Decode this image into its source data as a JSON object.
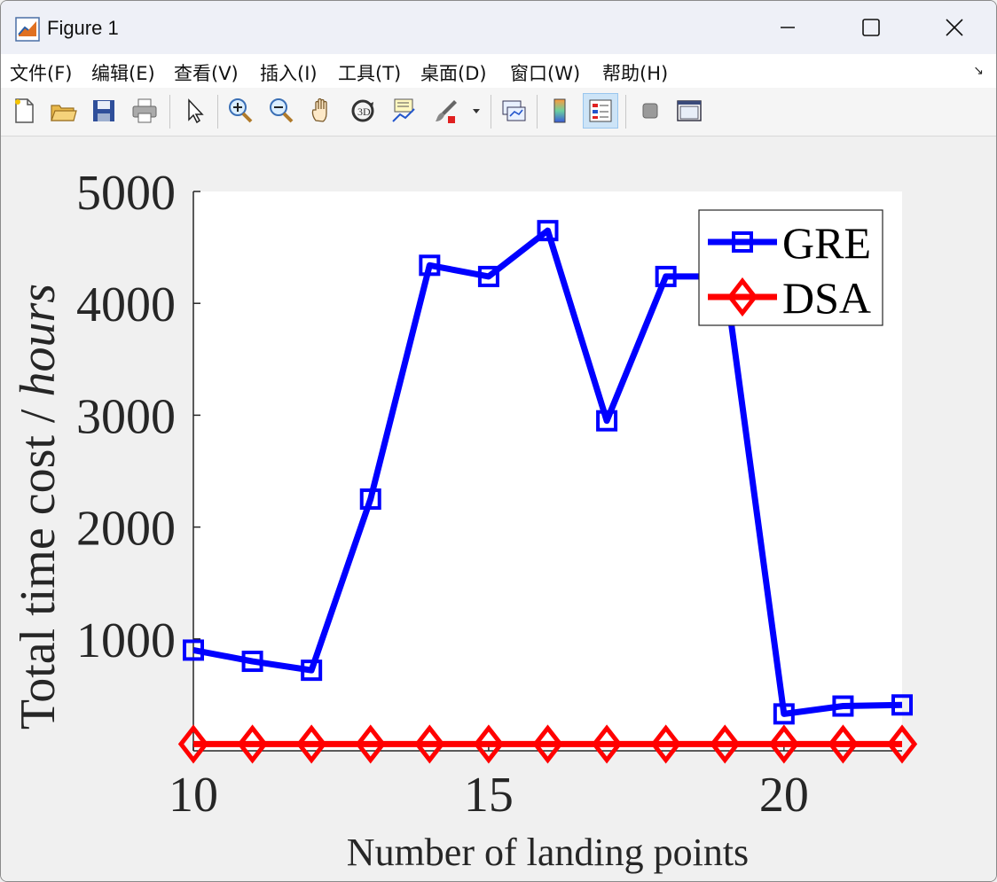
{
  "window": {
    "title": "Figure 1"
  },
  "menu": [
    "文件(F)",
    "编辑(E)",
    "查看(V)",
    "插入(I)",
    "工具(T)",
    "桌面(D)",
    "窗口(W)",
    "帮助(H)"
  ],
  "toolbar": [
    "new-figure-icon",
    "open-file-icon",
    "save-icon",
    "print-icon",
    "pointer-icon",
    "zoom-in-icon",
    "zoom-out-icon",
    "pan-icon",
    "rotate-3d-icon",
    "data-cursor-icon",
    "brush-icon",
    "link-plot-icon",
    "colorbar-icon",
    "legend-icon",
    "hide-plot-tools-icon",
    "show-plot-tools-icon"
  ],
  "chart_data": {
    "type": "line",
    "xlabel": "Number of landing points",
    "ylabel_main": "Total time cost / ",
    "ylabel_unit": "hours",
    "x": [
      10,
      11,
      12,
      13,
      14,
      15,
      16,
      17,
      18,
      19,
      20,
      21,
      22
    ],
    "xlim": [
      10,
      22
    ],
    "ylim": [
      0,
      5000
    ],
    "xticks": [
      10,
      15,
      20
    ],
    "yticks": [
      1000,
      2000,
      3000,
      4000,
      5000
    ],
    "legend_position": "top-right",
    "series": [
      {
        "name": "GRE",
        "color": "#0000ff",
        "marker": "square",
        "values": [
          900,
          800,
          720,
          2250,
          4340,
          4240,
          4650,
          2950,
          4240,
          4240,
          330,
          400,
          410
        ]
      },
      {
        "name": "DSA",
        "color": "#ff0000",
        "marker": "diamond",
        "values": [
          60,
          60,
          60,
          60,
          60,
          60,
          60,
          60,
          60,
          60,
          60,
          60,
          60
        ]
      }
    ]
  }
}
